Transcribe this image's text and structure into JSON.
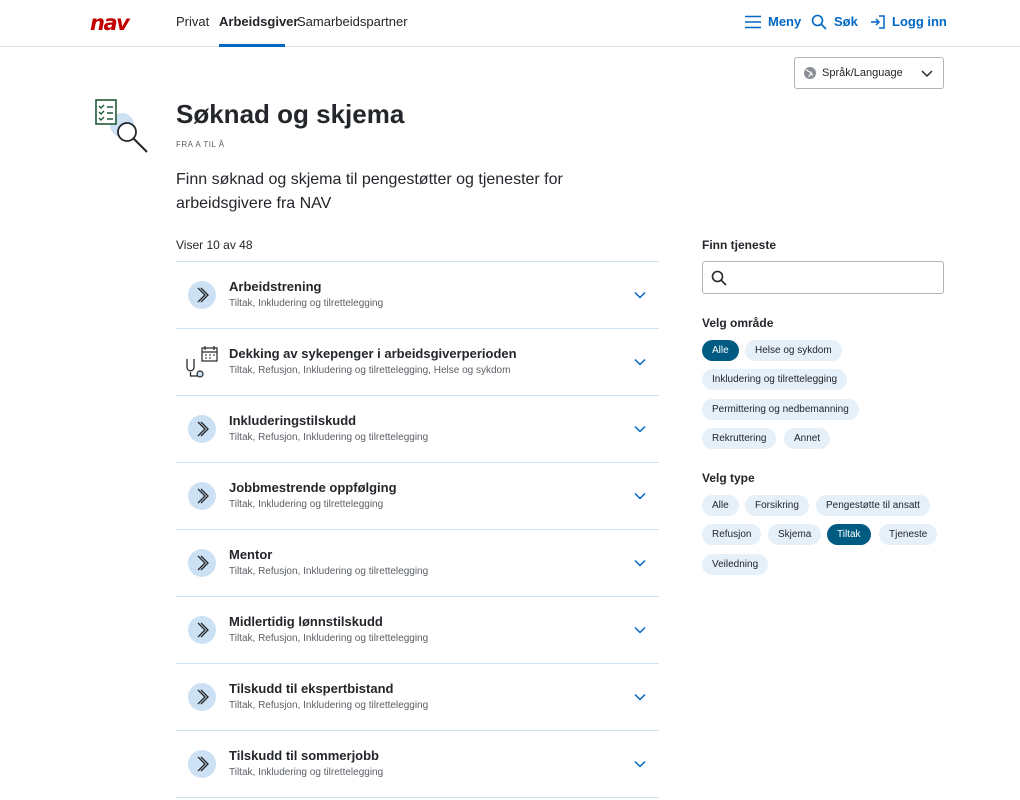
{
  "header": {
    "logo": "nav",
    "nav": [
      "Privat",
      "Arbeidsgiver",
      "Samarbeidspartner"
    ],
    "menu_label": "Meny",
    "search_label": "Søk",
    "login_label": "Logg inn"
  },
  "language": {
    "label": "Språk/Language"
  },
  "page": {
    "title": "Søknad og skjema",
    "eyebrow": "FRA A TIL Å",
    "lead": "Finn søknad og skjema til pengestøtter og tjenester for arbeidsgivere fra NAV",
    "count": "Viser 10 av 48"
  },
  "items": [
    {
      "name": "Arbeidstrening",
      "tags": "Tiltak, Inkludering og tilrettelegging",
      "icon": "chevron-circle-icon"
    },
    {
      "name": "Dekking av sykepenger i arbeidsgiverperioden",
      "tags": "Tiltak, Refusjon, Inkludering og tilrettelegging, Helse og sykdom",
      "icon": "stethoscope-calendar-icon"
    },
    {
      "name": "Inkluderingstilskudd",
      "tags": "Tiltak, Refusjon, Inkludering og tilrettelegging",
      "icon": "chevron-circle-icon"
    },
    {
      "name": "Jobbmestrende oppfølging",
      "tags": "Tiltak, Inkludering og tilrettelegging",
      "icon": "chevron-circle-icon"
    },
    {
      "name": "Mentor",
      "tags": "Tiltak, Refusjon, Inkludering og tilrettelegging",
      "icon": "chevron-circle-icon"
    },
    {
      "name": "Midlertidig lønnstilskudd",
      "tags": "Tiltak, Refusjon, Inkludering og tilrettelegging",
      "icon": "chevron-circle-icon"
    },
    {
      "name": "Tilskudd til ekspertbistand",
      "tags": "Tiltak, Refusjon, Inkludering og tilrettelegging",
      "icon": "chevron-circle-icon"
    },
    {
      "name": "Tilskudd til sommerjobb",
      "tags": "Tiltak, Inkludering og tilrettelegging",
      "icon": "chevron-circle-icon"
    }
  ],
  "sidebar": {
    "search_label": "Finn tjeneste",
    "search_value": "",
    "area_label": "Velg område",
    "areas": [
      "Alle",
      "Helse og sykdom",
      "Inkludering og tilrettelegging",
      "Permittering og nedbemanning",
      "Rekruttering",
      "Annet"
    ],
    "area_selected": "Alle",
    "type_label": "Velg type",
    "types": [
      "Alle",
      "Forsikring",
      "Pengestøtte til ansatt",
      "Refusjon",
      "Skjema",
      "Tiltak",
      "Tjeneste",
      "Veiledning"
    ],
    "type_selected": "Tiltak"
  },
  "colors": {
    "brand_red": "#c30000",
    "link_blue": "#0067c5",
    "chip_bg": "#e6f0f9",
    "chip_selected_bg": "#005b82",
    "icon_circle_bg": "#cce1f3"
  }
}
